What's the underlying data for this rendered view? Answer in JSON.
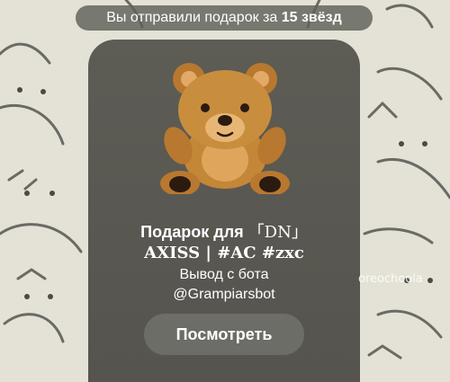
{
  "service_message": {
    "prefix": "Вы отправили подарок за ",
    "amount": "15 звёзд"
  },
  "gift": {
    "icon": "teddy-bear",
    "title_prefix": "Подарок для ",
    "title_name": "「DN」",
    "subtitle": "AXISS | #AC #zxc",
    "description_line1": "Вывод с бота",
    "description_line2": "@Grampiarsbot",
    "button_label": "Посмотреть"
  },
  "watermark": "oreochoola",
  "colors": {
    "wallpaper": "#e4e2d6",
    "card": "#5d5c55",
    "bear": "#c98d3e"
  }
}
